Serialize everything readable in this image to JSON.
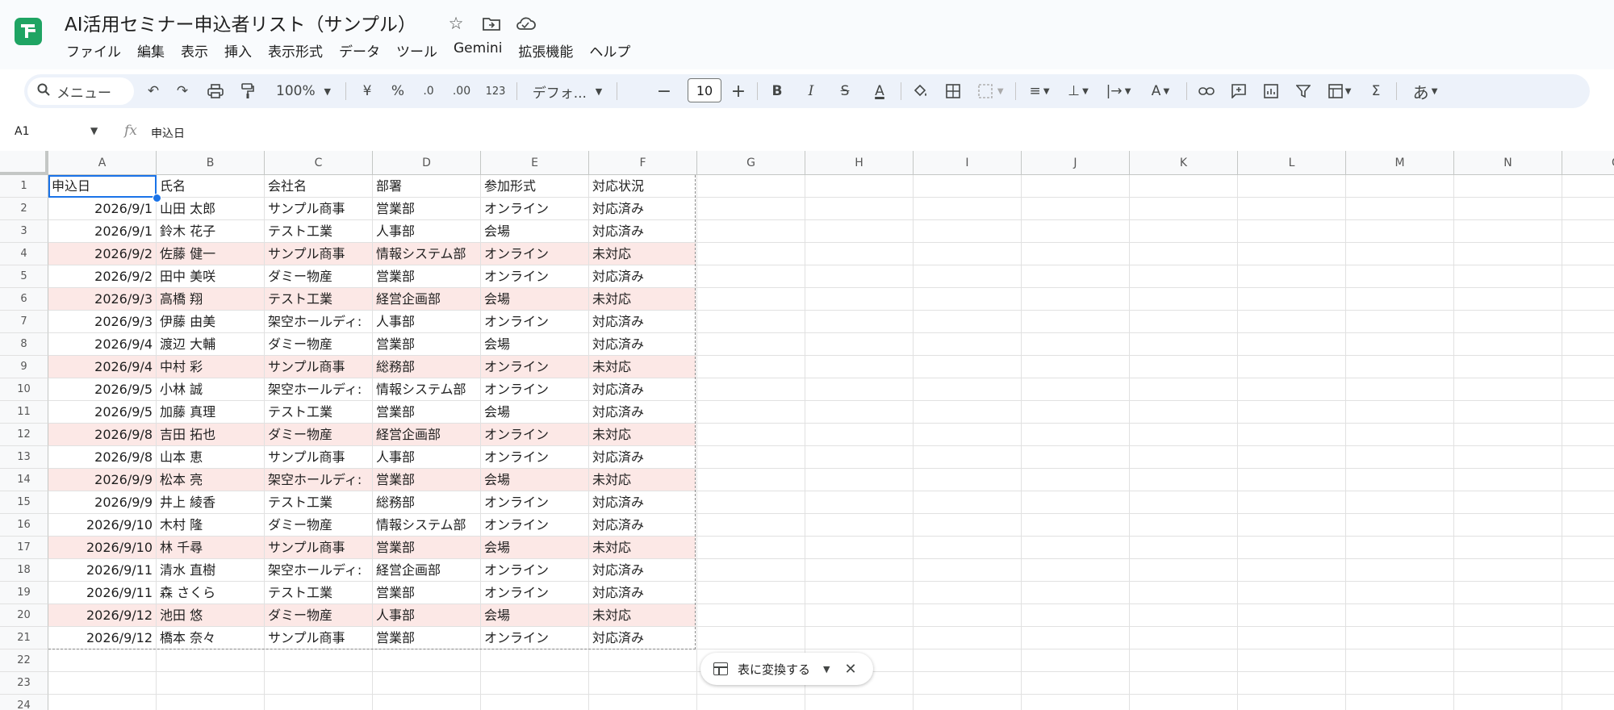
{
  "title_bar": {
    "doc_title": "AI活用セミナー申込者リスト（サンプル）",
    "icons": [
      "star-icon",
      "move-to-folder-icon",
      "cloud-status-icon"
    ]
  },
  "menu": [
    "ファイル",
    "編集",
    "表示",
    "挿入",
    "表示形式",
    "データ",
    "ツール",
    "Gemini",
    "拡張機能",
    "ヘルプ"
  ],
  "toolbar": {
    "search_label": "メニュー",
    "zoom": "100%",
    "currency": "¥",
    "percent": "%",
    "decrease_decimal": ".0",
    "increase_decimal": ".00",
    "number_format": "123",
    "font": "デフォ...",
    "font_size": "10",
    "bold": "B",
    "italic": "I",
    "strike": "S",
    "text_color": "A",
    "input_tools": "あ"
  },
  "formula_bar": {
    "name_box": "A1",
    "fx": "fx",
    "value": "申込日"
  },
  "columns": [
    "A",
    "B",
    "C",
    "D",
    "E",
    "F",
    "G",
    "H",
    "I",
    "J",
    "K",
    "L",
    "M",
    "N",
    "O"
  ],
  "row_numbers": [
    "1",
    "2",
    "3",
    "4",
    "5",
    "6",
    "7",
    "8",
    "9",
    "10",
    "11",
    "12",
    "13",
    "14",
    "15",
    "16",
    "17",
    "18",
    "19",
    "20",
    "21",
    "22",
    "23",
    "24"
  ],
  "table": {
    "header": [
      "申込日",
      "氏名",
      "会社名",
      "部署",
      "参加形式",
      "対応状況"
    ],
    "rows": [
      {
        "date": "2026/9/1",
        "name": "山田 太郎",
        "company": "サンプル商事",
        "dept": "営業部",
        "format": "オンライン",
        "status": "対応済み",
        "highlight": false
      },
      {
        "date": "2026/9/1",
        "name": "鈴木 花子",
        "company": "テスト工業",
        "dept": "人事部",
        "format": "会場",
        "status": "対応済み",
        "highlight": false
      },
      {
        "date": "2026/9/2",
        "name": "佐藤 健一",
        "company": "サンプル商事",
        "dept": "情報システム部",
        "format": "オンライン",
        "status": "未対応",
        "highlight": true
      },
      {
        "date": "2026/9/2",
        "name": "田中 美咲",
        "company": "ダミー物産",
        "dept": "営業部",
        "format": "オンライン",
        "status": "対応済み",
        "highlight": false
      },
      {
        "date": "2026/9/3",
        "name": "高橋 翔",
        "company": "テスト工業",
        "dept": "経営企画部",
        "format": "会場",
        "status": "未対応",
        "highlight": true
      },
      {
        "date": "2026/9/3",
        "name": "伊藤 由美",
        "company": "架空ホールディ:",
        "dept": "人事部",
        "format": "オンライン",
        "status": "対応済み",
        "highlight": false
      },
      {
        "date": "2026/9/4",
        "name": "渡辺 大輔",
        "company": "ダミー物産",
        "dept": "営業部",
        "format": "会場",
        "status": "対応済み",
        "highlight": false
      },
      {
        "date": "2026/9/4",
        "name": "中村 彩",
        "company": "サンプル商事",
        "dept": "総務部",
        "format": "オンライン",
        "status": "未対応",
        "highlight": true
      },
      {
        "date": "2026/9/5",
        "name": "小林 誠",
        "company": "架空ホールディ:",
        "dept": "情報システム部",
        "format": "オンライン",
        "status": "対応済み",
        "highlight": false
      },
      {
        "date": "2026/9/5",
        "name": "加藤 真理",
        "company": "テスト工業",
        "dept": "営業部",
        "format": "会場",
        "status": "対応済み",
        "highlight": false
      },
      {
        "date": "2026/9/8",
        "name": "吉田 拓也",
        "company": "ダミー物産",
        "dept": "経営企画部",
        "format": "オンライン",
        "status": "未対応",
        "highlight": true
      },
      {
        "date": "2026/9/8",
        "name": "山本 恵",
        "company": "サンプル商事",
        "dept": "人事部",
        "format": "オンライン",
        "status": "対応済み",
        "highlight": false
      },
      {
        "date": "2026/9/9",
        "name": "松本 亮",
        "company": "架空ホールディ:",
        "dept": "営業部",
        "format": "会場",
        "status": "未対応",
        "highlight": true
      },
      {
        "date": "2026/9/9",
        "name": "井上 綾香",
        "company": "テスト工業",
        "dept": "総務部",
        "format": "オンライン",
        "status": "対応済み",
        "highlight": false
      },
      {
        "date": "2026/9/10",
        "name": "木村 隆",
        "company": "ダミー物産",
        "dept": "情報システム部",
        "format": "オンライン",
        "status": "対応済み",
        "highlight": false
      },
      {
        "date": "2026/9/10",
        "name": "林 千尋",
        "company": "サンプル商事",
        "dept": "営業部",
        "format": "会場",
        "status": "未対応",
        "highlight": true
      },
      {
        "date": "2026/9/11",
        "name": "清水 直樹",
        "company": "架空ホールディ:",
        "dept": "経営企画部",
        "format": "オンライン",
        "status": "対応済み",
        "highlight": false
      },
      {
        "date": "2026/9/11",
        "name": "森 さくら",
        "company": "テスト工業",
        "dept": "営業部",
        "format": "オンライン",
        "status": "対応済み",
        "highlight": false
      },
      {
        "date": "2026/9/12",
        "name": "池田 悠",
        "company": "ダミー物産",
        "dept": "人事部",
        "format": "会場",
        "status": "未対応",
        "highlight": true
      },
      {
        "date": "2026/9/12",
        "name": "橋本 奈々",
        "company": "サンプル商事",
        "dept": "営業部",
        "format": "オンライン",
        "status": "対応済み",
        "highlight": false
      }
    ]
  },
  "colors": {
    "highlight_row": "#fce8e6",
    "selection": "#1a73e8",
    "app_green": "#1fa463"
  },
  "convert_chip": {
    "label": "表に変換する"
  }
}
